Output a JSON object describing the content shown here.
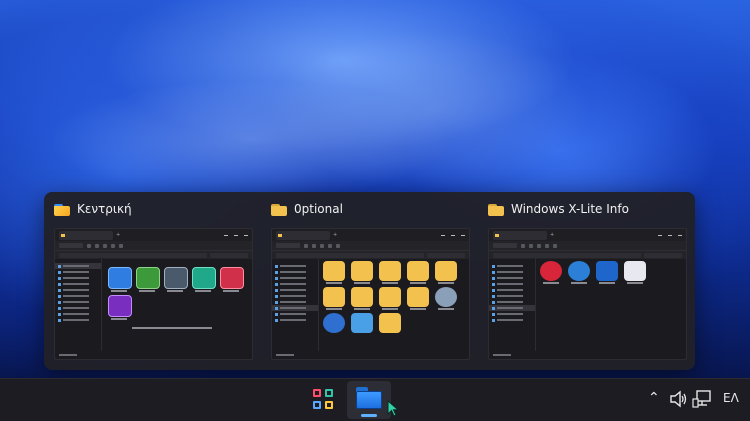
{
  "switcher": {
    "windows": [
      {
        "title": "Κεντρική",
        "icon": "folder-home-icon"
      },
      {
        "title": "0ptional",
        "icon": "folder-icon"
      },
      {
        "title": "Windows X-Lite Info",
        "icon": "folder-icon"
      }
    ]
  },
  "taskbar": {
    "start_icon": "start-icon",
    "explorer_icon": "file-explorer-icon",
    "language": "ΕΛ",
    "tray_icons": [
      "chevron-up-icon",
      "volume-icon",
      "network-icon"
    ]
  },
  "colors": {
    "start_tiles": [
      "#ff4d6a",
      "#34c4a8",
      "#5aa7ff",
      "#ffc83d"
    ],
    "explorer_folder": "#2f88f5",
    "folder_yellow": "#f2c14e",
    "accent": "#5fb0ff"
  }
}
